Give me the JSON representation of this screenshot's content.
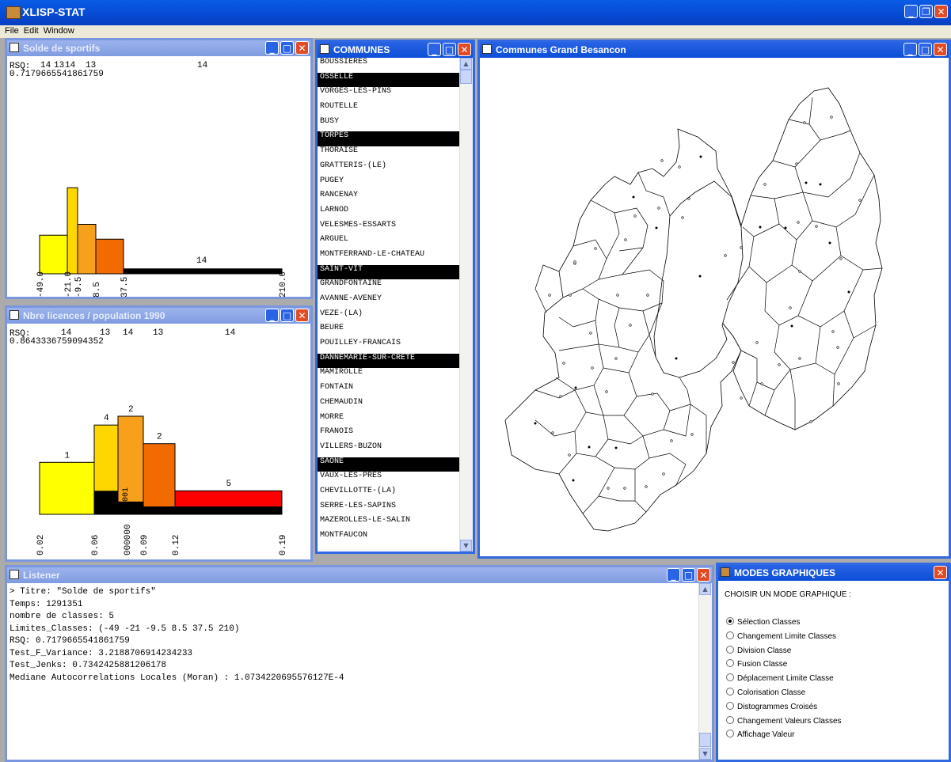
{
  "app": {
    "title": "XLISP-STAT",
    "menu": [
      "File",
      "Edit",
      "Window"
    ]
  },
  "win_solde": {
    "title": "Solde de sportifs",
    "rsq_label": "RSQ:",
    "rsq_value": "0.7179665541861759",
    "top_counts": [
      "14",
      "13",
      "14",
      "13",
      "14"
    ],
    "chart_data": {
      "type": "bar",
      "title": "Solde de sportifs",
      "class_limits": [
        -49.0,
        -21.0,
        -9.5,
        8.5,
        37.5,
        210.0
      ],
      "tick_labels": [
        "-49.0",
        "-21.0",
        "-9.5",
        "8.5",
        "37.5",
        "210.0"
      ],
      "bars": [
        {
          "from": -49.0,
          "to": -21.0,
          "height": 0.39,
          "color": "#ffff00"
        },
        {
          "from": -21.0,
          "to": -9.5,
          "height": 0.87,
          "color": "#ffd700"
        },
        {
          "from": -9.5,
          "to": 8.5,
          "height": 0.5,
          "color": "#f7a01c"
        },
        {
          "from": 8.5,
          "to": 37.5,
          "height": 0.35,
          "color": "#f26b00"
        },
        {
          "from": 37.5,
          "to": 210.0,
          "height": 0.05,
          "color": "#000000"
        }
      ],
      "bar_labels": [
        {
          "class": 5,
          "text": "14"
        }
      ]
    }
  },
  "win_licences": {
    "title": "Nbre licences / population 1990",
    "rsq_label": "RSQ:",
    "rsq_value": "0.8643336759094352",
    "top_counts": [
      "14",
      "13",
      "14",
      "13",
      "14"
    ],
    "chart_data": {
      "type": "bar",
      "title": "Nbre licences / population 1990",
      "class_limits": [
        0.02,
        0.06,
        0.07,
        0.09,
        0.12,
        0.19
      ],
      "tick_labels": [
        "0.02",
        "0.06",
        "000000",
        "0.09",
        "0.12",
        "0.19"
      ],
      "bars": [
        {
          "from": 0.02,
          "to": 0.06,
          "height": 0.53,
          "color": "#ffff00",
          "selected": 0.0,
          "label": "1"
        },
        {
          "from": 0.06,
          "to": 0.07,
          "height": 0.91,
          "color": "#ffd700",
          "selected": 0.24,
          "label": "4"
        },
        {
          "from": 0.07,
          "to": 0.09,
          "height": 1.0,
          "color": "#f7a01c",
          "selected": 0.13,
          "label": "2"
        },
        {
          "from": 0.09,
          "to": 0.12,
          "height": 0.72,
          "color": "#f26b00",
          "selected": 0.08,
          "label": "2"
        },
        {
          "from": 0.12,
          "to": 0.19,
          "height": 0.24,
          "color": "#ff0000",
          "selected": 0.08,
          "label": "5"
        }
      ],
      "overlay_text": "0001"
    }
  },
  "win_communes": {
    "title": "COMMUNES",
    "items": [
      {
        "name": "BOUSSIERES",
        "selected": false
      },
      {
        "name": "OSSELLE",
        "selected": true
      },
      {
        "name": "VORGES-LES-PINS",
        "selected": false
      },
      {
        "name": "ROUTELLE",
        "selected": false
      },
      {
        "name": "BUSY",
        "selected": false
      },
      {
        "name": "TORPES",
        "selected": true
      },
      {
        "name": "THORAISE",
        "selected": false
      },
      {
        "name": "GRATTERIS-(LE)",
        "selected": false
      },
      {
        "name": "PUGEY",
        "selected": false
      },
      {
        "name": "RANCENAY",
        "selected": false
      },
      {
        "name": "LARNOD",
        "selected": false
      },
      {
        "name": "VELESMES-ESSARTS",
        "selected": false
      },
      {
        "name": "ARGUEL",
        "selected": false
      },
      {
        "name": "MONTFERRAND-LE-CHATEAU",
        "selected": false
      },
      {
        "name": "SAINT-VIT",
        "selected": true
      },
      {
        "name": "GRANDFONTAINE",
        "selected": false
      },
      {
        "name": "AVANNE-AVENEY",
        "selected": false
      },
      {
        "name": "VEZE-(LA)",
        "selected": false
      },
      {
        "name": "BEURE",
        "selected": false
      },
      {
        "name": "POUILLEY-FRANCAIS",
        "selected": false
      },
      {
        "name": "DANNEMARIE-SUR-CRETE",
        "selected": true
      },
      {
        "name": "MAMIROLLE",
        "selected": false
      },
      {
        "name": "FONTAIN",
        "selected": false
      },
      {
        "name": "CHEMAUDIN",
        "selected": false
      },
      {
        "name": "MORRE",
        "selected": false
      },
      {
        "name": "FRANOIS",
        "selected": false
      },
      {
        "name": "VILLERS-BUZON",
        "selected": false
      },
      {
        "name": "SAONE",
        "selected": true
      },
      {
        "name": "VAUX-LES-PRES",
        "selected": false
      },
      {
        "name": "CHEVILLOTTE-(LA)",
        "selected": false
      },
      {
        "name": "SERRE-LES-SAPINS",
        "selected": false
      },
      {
        "name": "MAZEROLLES-LE-SALIN",
        "selected": false
      },
      {
        "name": "MONTFAUCON",
        "selected": false
      }
    ]
  },
  "win_map": {
    "title": "Communes Grand Besancon"
  },
  "win_listener": {
    "title": "Listener",
    "lines": [
      "> Titre: \"Solde de sportifs\"",
      "Temps: 1291351",
      "nombre de classes: 5",
      "Limites_Classes: (-49 -21 -9.5 8.5 37.5 210)",
      "RSQ: 0.7179665541861759",
      "Test_F_Variance: 3.2188706914234233",
      "Test_Jenks: 0.7342425881206178",
      "Mediane Autocorrelations Locales (Moran) : 1.0734220695576127E-4"
    ]
  },
  "win_modes": {
    "title": "MODES GRAPHIQUES",
    "heading": "CHOISIR UN MODE GRAPHIQUE :",
    "options": [
      {
        "label": "Sélection Classes",
        "checked": true
      },
      {
        "label": "Changement Limite Classes",
        "checked": false
      },
      {
        "label": "Division Classe",
        "checked": false
      },
      {
        "label": "Fusion Classe",
        "checked": false
      },
      {
        "label": "Déplacement Limite Classe",
        "checked": false
      },
      {
        "label": "Colorisation Classe",
        "checked": false
      },
      {
        "label": "Distogrammes Croisés",
        "checked": false
      },
      {
        "label": "Changement Valeurs Classes",
        "checked": false
      },
      {
        "label": "Affichage Valeur",
        "checked": false
      }
    ]
  }
}
